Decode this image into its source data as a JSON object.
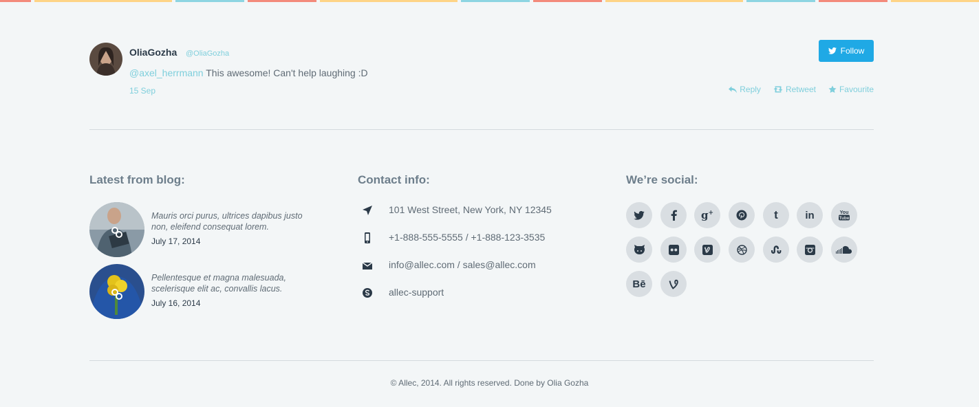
{
  "colors": {
    "top_bar": [
      "#f38a7b",
      "#fed486",
      "#8dd5e2",
      "#f38a7b",
      "#fed486",
      "#8dd5e2",
      "#f38a7b",
      "#fed486",
      "#8dd5e2",
      "#f38a7b",
      "#fed486"
    ],
    "accent": "#7fcfdc",
    "follow_button": "#1fa9e5",
    "social_bg": "#d9dee2"
  },
  "tweet": {
    "author_name": "OliaGozha",
    "author_handle": "@OliaGozha",
    "mention": "@axel_herrmann",
    "text": " This awesome! Can't help laughing :D",
    "date": "15 Sep",
    "follow_label": "Follow",
    "actions": {
      "reply": "Reply",
      "retweet": "Retweet",
      "favourite": "Favourite"
    }
  },
  "blog": {
    "title": "Latest from blog:",
    "posts": [
      {
        "text": "Mauris orci purus, ultrices dapibus justo non, eleifend consequat lorem.",
        "date": "July 17, 2014"
      },
      {
        "text": "Pellentesque et magna malesuada, scelerisque elit ac, convallis lacus.",
        "date": "July 16, 2014"
      }
    ]
  },
  "contact": {
    "title": "Contact info:",
    "items": [
      {
        "icon": "location-arrow-icon",
        "text": "101 West Street, New York, NY 12345"
      },
      {
        "icon": "mobile-phone-icon",
        "text": "+1-888-555-5555 / +1-888-123-3535"
      },
      {
        "icon": "envelope-icon",
        "text": "info@allec.com / sales@allec.com"
      },
      {
        "icon": "skype-icon",
        "text": "allec-support"
      }
    ]
  },
  "social": {
    "title": "We’re social:",
    "icons": [
      "twitter-icon",
      "facebook-icon",
      "google-plus-icon",
      "pinterest-icon",
      "tumblr-icon",
      "linkedin-icon",
      "youtube-icon",
      "github-icon",
      "flickr-icon",
      "vimeo-icon",
      "dribbble-icon",
      "stumbleupon-icon",
      "instagram-icon",
      "soundcloud-icon",
      "behance-icon",
      "vine-icon"
    ]
  },
  "footer": {
    "copyright": "© Allec, 2014. All rights reserved. Done by Olia Gozha"
  }
}
